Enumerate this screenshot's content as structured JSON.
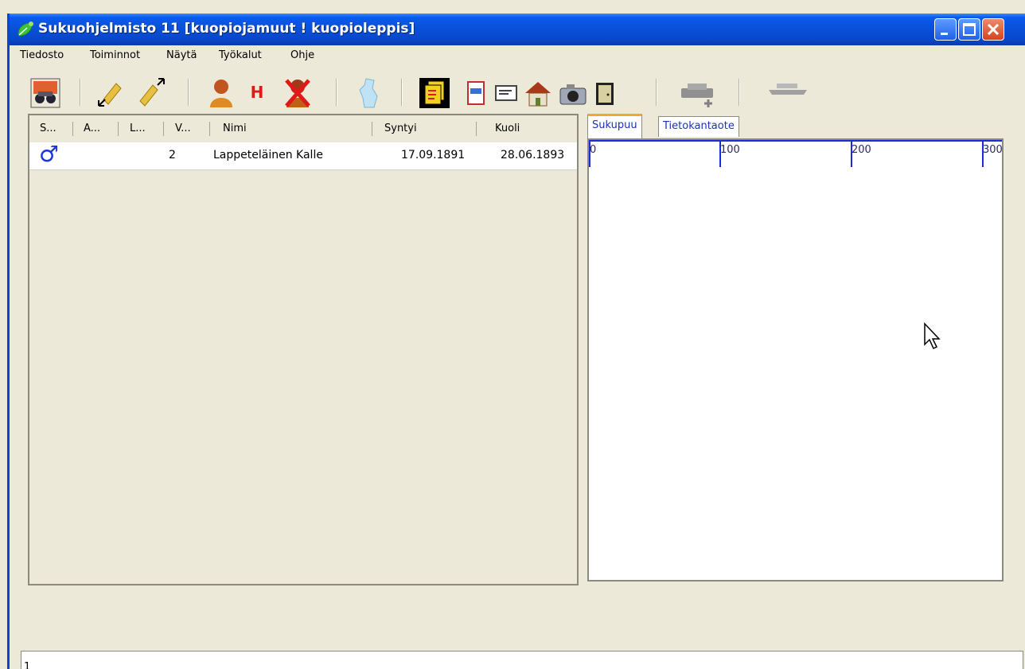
{
  "window": {
    "title": "Sukuohjelmisto 11 [kuopiojamuut ! kuopioleppis]"
  },
  "menu": [
    "Tiedosto",
    "Toiminnot",
    "Näytä",
    "Työkalut",
    "Ohje"
  ],
  "toolbar_icons": [
    "binoculars-icon",
    "pencil-collapse-icon",
    "pencil-expand-icon",
    "person-icon",
    "h-icon",
    "person-delete-icon",
    "map-icon",
    "documents-icon",
    "id-card-icon",
    "envelope-icon",
    "house-icon",
    "camera-icon",
    "door-icon",
    "stamp-add-icon",
    "scanner-icon"
  ],
  "toolbar_h_label": "H",
  "table": {
    "headers": [
      "S...",
      "A...",
      "L...",
      "V...",
      "Nimi",
      "Syntyi",
      "Kuoli"
    ],
    "rows": [
      {
        "gender_symbol": "♂",
        "gender_color": "#1d35d8",
        "v": "2",
        "name": "Lappeteläinen Kalle",
        "born": "17.09.1891",
        "died": "28.06.1893"
      }
    ]
  },
  "tabs": [
    "Sukupuu",
    "Tietokantaote"
  ],
  "active_tab": "Sukupuu",
  "ruler": {
    "labels": [
      "0",
      "100",
      "200",
      "300"
    ],
    "color": "#1f2bd8"
  },
  "status": {
    "text": "1"
  }
}
